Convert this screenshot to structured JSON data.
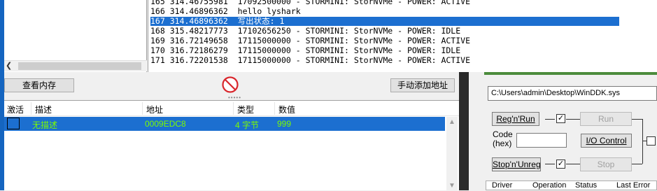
{
  "log": {
    "lines": [
      {
        "num": "165",
        "time": "314.46755981",
        "text": "17092500000 - STORMINI: StorNVMe - POWER: ACTIVE",
        "selected": false
      },
      {
        "num": "166",
        "time": "314.46896362",
        "text": "hello lyshark",
        "selected": false
      },
      {
        "num": "167",
        "time": "314.46896362",
        "text": "写出状态: 1",
        "selected": true
      },
      {
        "num": "168",
        "time": "315.48217773",
        "text": "17102656250 - STORMINI: StorNVMe - POWER: IDLE",
        "selected": false
      },
      {
        "num": "169",
        "time": "316.72149658",
        "text": "17115000000 - STORMINI: StorNVMe - POWER: ACTIVE",
        "selected": false
      },
      {
        "num": "170",
        "time": "316.72186279",
        "text": "17115000000 - STORMINI: StorNVMe - POWER: IDLE",
        "selected": false
      },
      {
        "num": "171",
        "time": "316.72201538",
        "text": "17115000000 - STORMINI: StorNVMe - POWER: ACTIVE",
        "selected": false
      }
    ]
  },
  "cheat": {
    "view_memory_label": "查看内存",
    "add_address_label": "手动添加地址",
    "columns": [
      "激活",
      "描述",
      "地址",
      "类型",
      "数值"
    ],
    "rows": [
      {
        "active": false,
        "description": "无描述",
        "address": "0009EDC8",
        "type": "4 字节",
        "value": "999"
      }
    ]
  },
  "driver": {
    "path": "C:\\Users\\admin\\Desktop\\WinDDK.sys",
    "reg_run_label": "Reg'n'Run",
    "run_label": "Run",
    "code_label_1": "Code",
    "code_label_2": "(hex)",
    "code_value": "",
    "io_control_label": "I/O Control",
    "stop_unreg_label": "Stop'n'Unreg",
    "stop_label": "Stop",
    "list_columns": [
      "Driver",
      "Operation",
      "Status",
      "Last Error"
    ]
  },
  "colors": {
    "selection": "#1c6fd0",
    "row_text": "#7cfc00",
    "stop_icon": "#d9262c"
  }
}
